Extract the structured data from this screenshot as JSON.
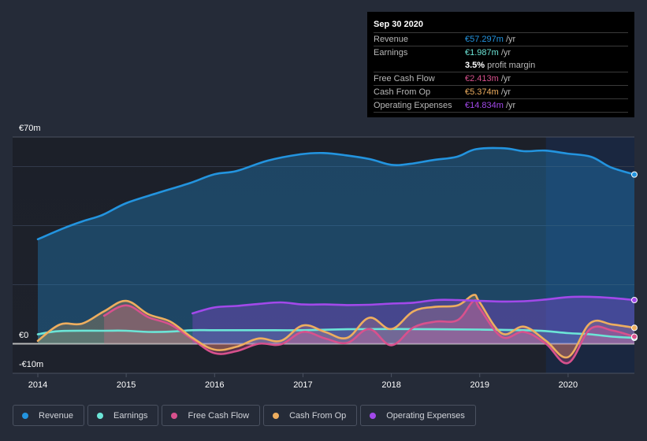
{
  "tooltip": {
    "date": "Sep 30 2020",
    "rows": [
      {
        "label": "Revenue",
        "value": "€57.297m",
        "unit": "/yr",
        "color": "#2394df"
      },
      {
        "label": "Earnings",
        "value": "€1.987m",
        "unit": "/yr",
        "color": "#6ce5d7"
      },
      {
        "label": "",
        "margin_value": "3.5%",
        "margin_text": "profit margin"
      },
      {
        "label": "Free Cash Flow",
        "value": "€2.413m",
        "unit": "/yr",
        "color": "#d8518d"
      },
      {
        "label": "Cash From Op",
        "value": "€5.374m",
        "unit": "/yr",
        "color": "#eeae5f"
      },
      {
        "label": "Operating Expenses",
        "value": "€14.834m",
        "unit": "/yr",
        "color": "#a249ea"
      }
    ]
  },
  "legend": [
    {
      "label": "Revenue",
      "color": "#2394df"
    },
    {
      "label": "Earnings",
      "color": "#6ce5d7"
    },
    {
      "label": "Free Cash Flow",
      "color": "#d8518d"
    },
    {
      "label": "Cash From Op",
      "color": "#eeae5f"
    },
    {
      "label": "Operating Expenses",
      "color": "#a249ea"
    }
  ],
  "chart_data": {
    "type": "area",
    "title": "",
    "xlabel": "",
    "ylabel": "",
    "currency": "€",
    "y_tick_labels": [
      "€70m",
      "€0",
      "-€10m"
    ],
    "y_gridlines": [
      70,
      60,
      40,
      20,
      0,
      -10
    ],
    "ylim": [
      -10,
      70
    ],
    "xlim": [
      2014.0,
      2020.75
    ],
    "x_tick_labels": [
      "2014",
      "2015",
      "2016",
      "2017",
      "2018",
      "2019",
      "2020"
    ],
    "x_ticks": [
      2014,
      2015,
      2016,
      2017,
      2018,
      2019,
      2020
    ],
    "highlight_start": 2019.75,
    "grid": true,
    "legend_position": "bottom-left",
    "series": [
      {
        "name": "Revenue",
        "color": "#2394df",
        "x": [
          2014.0,
          2014.29,
          2014.51,
          2014.73,
          2015.0,
          2015.36,
          2015.71,
          2016.0,
          2016.25,
          2016.6,
          2016.96,
          2017.23,
          2017.49,
          2017.76,
          2018.0,
          2018.21,
          2018.47,
          2018.74,
          2018.96,
          2019.28,
          2019.5,
          2019.74,
          2019.99,
          2020.26,
          2020.48,
          2020.75
        ],
        "values": [
          35.4,
          39.1,
          41.5,
          43.6,
          47.6,
          51.1,
          54.3,
          57.4,
          58.5,
          62.0,
          64.1,
          64.6,
          63.8,
          62.5,
          60.6,
          60.9,
          62.2,
          63.3,
          65.9,
          66.2,
          65.2,
          65.4,
          64.4,
          63.3,
          59.8,
          57.3
        ]
      },
      {
        "name": "Earnings",
        "color": "#6ce5d7",
        "x": [
          2014.0,
          2014.25,
          2014.75,
          2015.0,
          2015.25,
          2015.5,
          2015.75,
          2016.0,
          2016.5,
          2017.0,
          2017.5,
          2018.0,
          2018.5,
          2019.0,
          2019.5,
          2019.75,
          2020.0,
          2020.25,
          2020.5,
          2020.75
        ],
        "values": [
          3.2,
          4.3,
          4.4,
          4.4,
          4.0,
          4.1,
          4.6,
          4.6,
          4.6,
          4.6,
          4.9,
          5.0,
          4.9,
          4.8,
          4.6,
          4.3,
          3.6,
          3.2,
          2.4,
          2.0
        ]
      },
      {
        "name": "Free Cash Flow",
        "color": "#d8518d",
        "x": [
          2014.75,
          2015.0,
          2015.25,
          2015.5,
          2015.75,
          2016.0,
          2016.25,
          2016.5,
          2016.75,
          2017.0,
          2017.25,
          2017.5,
          2017.75,
          2018.0,
          2018.25,
          2018.5,
          2018.75,
          2018.93,
          2019.0,
          2019.25,
          2019.5,
          2019.75,
          2020.0,
          2020.25,
          2020.5,
          2020.75
        ],
        "values": [
          9.5,
          13.0,
          9.0,
          6.5,
          1.5,
          -3.2,
          -2.5,
          0.0,
          -0.2,
          4.0,
          1.8,
          0.3,
          5.0,
          -0.5,
          5.5,
          7.5,
          8.0,
          14.5,
          12.0,
          2.3,
          4.0,
          0.0,
          -6.5,
          5.0,
          4.5,
          2.4
        ]
      },
      {
        "name": "Cash From Op",
        "color": "#eeae5f",
        "x": [
          2014.0,
          2014.25,
          2014.5,
          2014.75,
          2015.0,
          2015.25,
          2015.5,
          2015.75,
          2016.0,
          2016.25,
          2016.5,
          2016.75,
          2017.0,
          2017.25,
          2017.5,
          2017.75,
          2018.0,
          2018.25,
          2018.5,
          2018.75,
          2018.93,
          2019.0,
          2019.25,
          2019.5,
          2019.75,
          2020.0,
          2020.25,
          2020.5,
          2020.75
        ],
        "values": [
          1.0,
          6.5,
          6.8,
          11.0,
          14.5,
          10.0,
          7.5,
          2.0,
          -2.0,
          -1.0,
          1.8,
          1.0,
          6.2,
          4.0,
          2.0,
          8.8,
          5.0,
          11.0,
          12.5,
          13.0,
          16.5,
          14.0,
          3.5,
          5.8,
          1.0,
          -4.5,
          7.0,
          6.5,
          5.4
        ]
      },
      {
        "name": "Operating Expenses",
        "color": "#a249ea",
        "x": [
          2015.75,
          2016.0,
          2016.25,
          2016.5,
          2016.75,
          2017.0,
          2017.25,
          2017.5,
          2017.75,
          2018.0,
          2018.25,
          2018.5,
          2018.75,
          2019.0,
          2019.25,
          2019.5,
          2019.75,
          2020.0,
          2020.25,
          2020.5,
          2020.75
        ],
        "values": [
          10.3,
          12.3,
          12.8,
          13.5,
          14.0,
          13.3,
          13.3,
          13.1,
          13.2,
          13.6,
          13.9,
          14.8,
          14.8,
          14.5,
          14.3,
          14.4,
          15.0,
          15.8,
          15.9,
          15.5,
          14.8
        ]
      }
    ]
  }
}
